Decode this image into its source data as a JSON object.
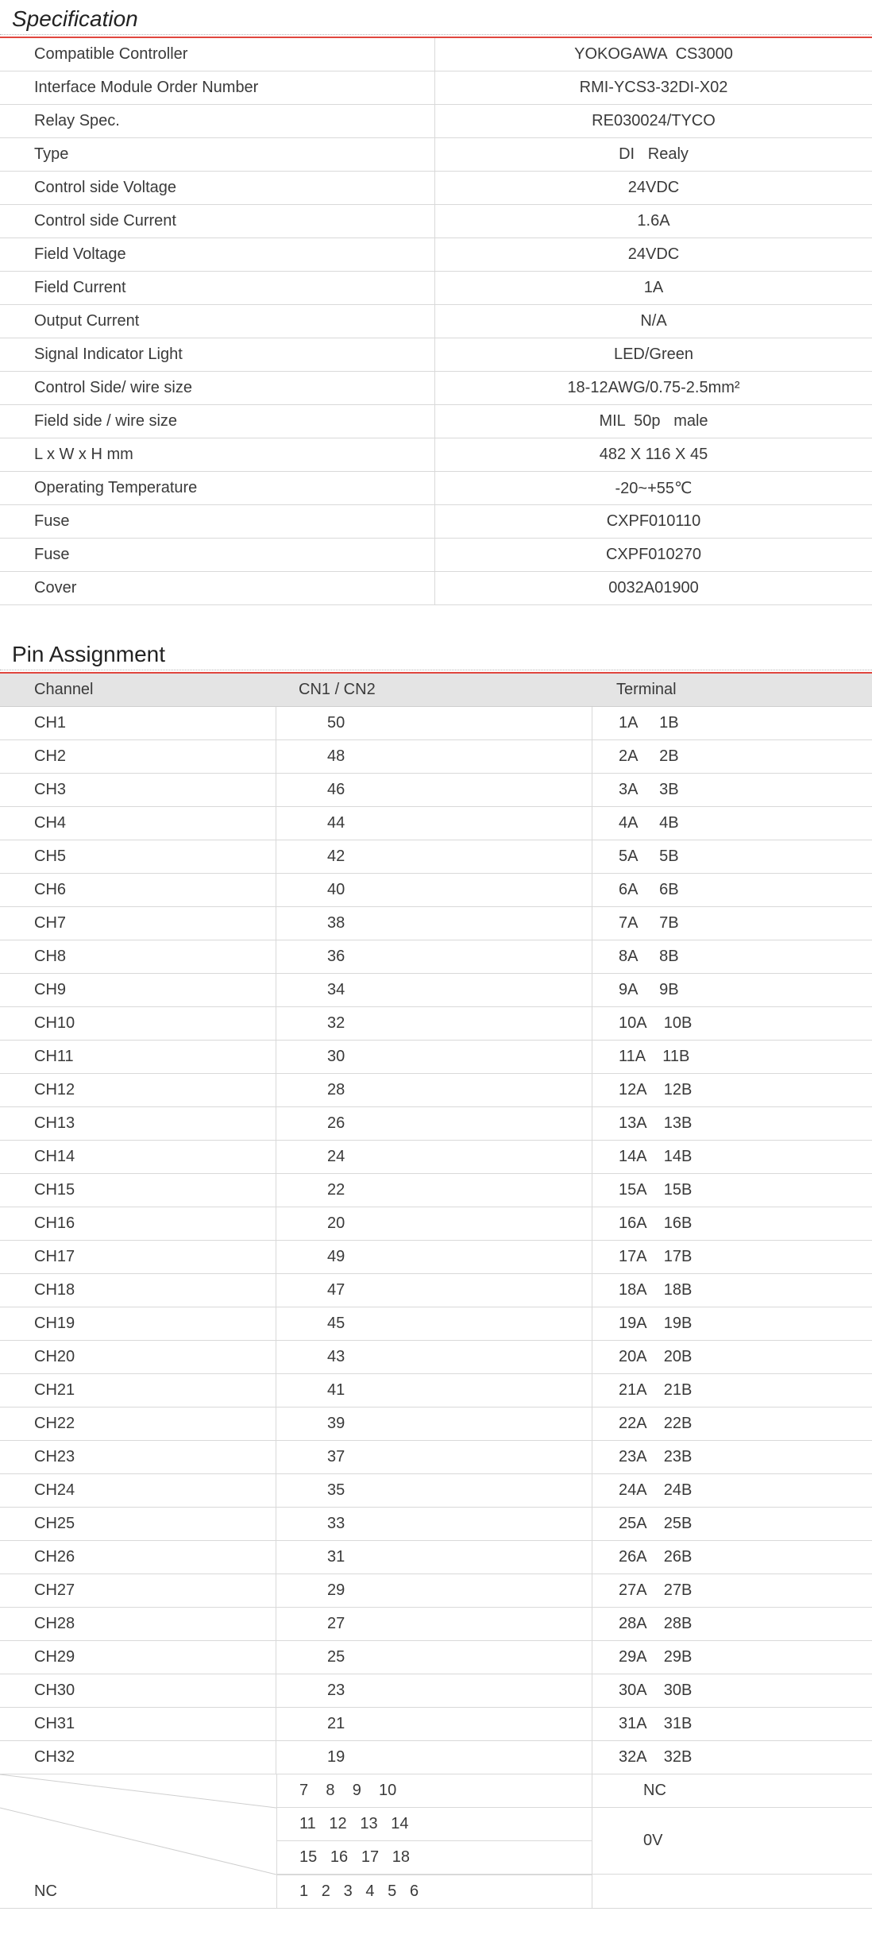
{
  "spec": {
    "title": "Specification",
    "rows": [
      {
        "label": "Compatible Controller",
        "value": "YOKOGAWA  CS3000"
      },
      {
        "label": "Interface Module Order Number",
        "value": "RMI-YCS3-32DI-X02"
      },
      {
        "label": "Relay Spec.",
        "value": "RE030024/TYCO"
      },
      {
        "label": "Type",
        "value": "DI   Realy"
      },
      {
        "label": "Control side Voltage",
        "value": "24VDC"
      },
      {
        "label": "Control side Current",
        "value": "1.6A"
      },
      {
        "label": "Field Voltage",
        "value": "24VDC"
      },
      {
        "label": "Field Current",
        "value": "1A"
      },
      {
        "label": "Output Current",
        "value": "N/A"
      },
      {
        "label": "Signal Indicator Light",
        "value": "LED/Green"
      },
      {
        "label": "Control Side/ wire size",
        "value": "18-12AWG/0.75-2.5mm²"
      },
      {
        "label": "Field side / wire size",
        "value": "MIL  50p   male"
      },
      {
        "label": "L x W x H mm",
        "value": "482 X 116 X 45"
      },
      {
        "label": "Operating Temperature",
        "value": "-20~+55℃"
      },
      {
        "label": "Fuse",
        "value": "CXPF010110"
      },
      {
        "label": "Fuse",
        "value": "CXPF010270"
      },
      {
        "label": "Cover",
        "value": "0032A01900"
      }
    ]
  },
  "pin": {
    "title": "Pin Assignment",
    "headers": {
      "channel": "Channel",
      "cn": "CN1 / CN2",
      "terminal": "Terminal"
    },
    "rows": [
      {
        "ch": "CH1",
        "cn": "50",
        "term": "1A     1B"
      },
      {
        "ch": "CH2",
        "cn": "48",
        "term": "2A     2B"
      },
      {
        "ch": "CH3",
        "cn": "46",
        "term": "3A     3B"
      },
      {
        "ch": "CH4",
        "cn": "44",
        "term": "4A     4B"
      },
      {
        "ch": "CH5",
        "cn": "42",
        "term": "5A     5B"
      },
      {
        "ch": "CH6",
        "cn": "40",
        "term": "6A     6B"
      },
      {
        "ch": "CH7",
        "cn": "38",
        "term": "7A     7B"
      },
      {
        "ch": "CH8",
        "cn": "36",
        "term": "8A     8B"
      },
      {
        "ch": "CH9",
        "cn": "34",
        "term": "9A     9B"
      },
      {
        "ch": "CH10",
        "cn": "32",
        "term": "10A    10B"
      },
      {
        "ch": "CH11",
        "cn": "30",
        "term": "11A    11B"
      },
      {
        "ch": "CH12",
        "cn": "28",
        "term": "12A    12B"
      },
      {
        "ch": "CH13",
        "cn": "26",
        "term": "13A    13B"
      },
      {
        "ch": "CH14",
        "cn": "24",
        "term": "14A    14B"
      },
      {
        "ch": "CH15",
        "cn": "22",
        "term": "15A    15B"
      },
      {
        "ch": "CH16",
        "cn": "20",
        "term": "16A    16B"
      },
      {
        "ch": "CH17",
        "cn": "49",
        "term": "17A    17B"
      },
      {
        "ch": "CH18",
        "cn": "47",
        "term": "18A    18B"
      },
      {
        "ch": "CH19",
        "cn": "45",
        "term": "19A    19B"
      },
      {
        "ch": "CH20",
        "cn": "43",
        "term": "20A    20B"
      },
      {
        "ch": "CH21",
        "cn": "41",
        "term": "21A    21B"
      },
      {
        "ch": "CH22",
        "cn": "39",
        "term": "22A    22B"
      },
      {
        "ch": "CH23",
        "cn": "37",
        "term": "23A    23B"
      },
      {
        "ch": "CH24",
        "cn": "35",
        "term": "24A    24B"
      },
      {
        "ch": "CH25",
        "cn": "33",
        "term": "25A    25B"
      },
      {
        "ch": "CH26",
        "cn": "31",
        "term": "26A    26B"
      },
      {
        "ch": "CH27",
        "cn": "29",
        "term": "27A    27B"
      },
      {
        "ch": "CH28",
        "cn": "27",
        "term": "28A    28B"
      },
      {
        "ch": "CH29",
        "cn": "25",
        "term": "29A    29B"
      },
      {
        "ch": "CH30",
        "cn": "23",
        "term": "30A    30B"
      },
      {
        "ch": "CH31",
        "cn": "21",
        "term": "31A    31B"
      },
      {
        "ch": "CH32",
        "cn": "19",
        "term": "32A    32B"
      }
    ],
    "nc": {
      "pins_nc": "7    8    9    10",
      "pins_0v_a": "11   12   13   14",
      "pins_0v_b": "15   16   17   18",
      "pins_last": "1   2   3   4   5   6",
      "term_nc": "NC",
      "term_0v": "0V",
      "label_nc": "NC"
    }
  }
}
